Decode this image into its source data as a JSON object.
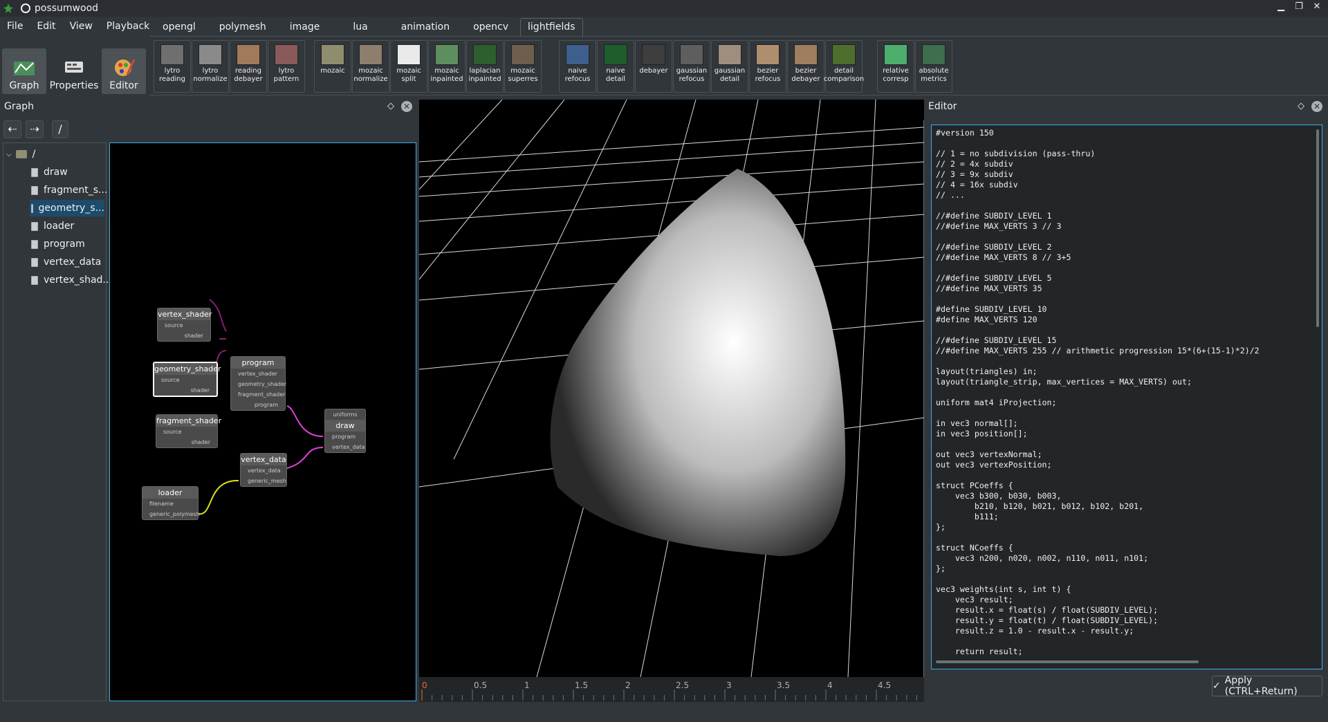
{
  "window": {
    "title": "possumwood",
    "controls": [
      "minimize-icon",
      "restore-icon",
      "close-icon"
    ]
  },
  "menu": [
    "File",
    "Edit",
    "View",
    "Playback"
  ],
  "tabs": [
    {
      "label": "opengl",
      "active": false
    },
    {
      "label": "polymesh",
      "active": false
    },
    {
      "label": "image",
      "active": false
    },
    {
      "label": "lua",
      "active": false
    },
    {
      "label": "animation",
      "active": false
    },
    {
      "label": "opencv",
      "active": false
    },
    {
      "label": "lightfields",
      "active": true
    }
  ],
  "modes": [
    {
      "label": "Graph",
      "icon": "graph-icon",
      "active": true
    },
    {
      "label": "Properties",
      "icon": "properties-icon",
      "active": false
    },
    {
      "label": "Editor",
      "icon": "editor-icon",
      "active": true
    }
  ],
  "tools": [
    {
      "label": "lytro\nreading",
      "thumb": "#6f6f70"
    },
    {
      "label": "lytro\nnormalize",
      "thumb": "#8a8a8a"
    },
    {
      "label": "reading\ndebayer",
      "thumb": "#a07a5a"
    },
    {
      "label": "lytro\npattern",
      "thumb": "#8a5a5a"
    },
    {
      "label": "mozaic",
      "thumb": "#8e8e6e"
    },
    {
      "label": "mozaic\nnormalize",
      "thumb": "#8e7e6e"
    },
    {
      "label": "mozaic\nsplit",
      "thumb": "#eaeaea"
    },
    {
      "label": "mozaic\ninpainted",
      "thumb": "#5e8e5e"
    },
    {
      "label": "laplacian\ninpainted",
      "thumb": "#2e5e2e"
    },
    {
      "label": "mozaic\nsuperres",
      "thumb": "#6e5e4e"
    },
    {
      "label": "naive\nrefocus",
      "thumb": "#3e5e8e"
    },
    {
      "label": "naive\ndetail",
      "thumb": "#1e5e2e"
    },
    {
      "label": "debayer",
      "thumb": "#3e3e3e"
    },
    {
      "label": "gaussian\nrefocus",
      "thumb": "#5e5e5e"
    },
    {
      "label": "gaussian\ndetail",
      "thumb": "#9e8e7e"
    },
    {
      "label": "bezier\nrefocus",
      "thumb": "#ae8e6e"
    },
    {
      "label": "bezier\ndebayer",
      "thumb": "#9e7e5e"
    },
    {
      "label": "detail\ncomparison",
      "thumb": "#4e6e2e"
    },
    {
      "label": "relative\ncorresp",
      "thumb": "#4eae6e"
    },
    {
      "label": "absolute\nmetrics",
      "thumb": "#3e6e4e"
    }
  ],
  "graph_panel": {
    "title": "Graph",
    "path": "/",
    "root": "/",
    "items": [
      "draw",
      "fragment_s...",
      "geometry_s...",
      "loader",
      "program",
      "vertex_data",
      "vertex_shad..."
    ],
    "selected": "geometry_s..."
  },
  "nodes": {
    "vertex_shader": {
      "title": "vertex_shader",
      "in": "source",
      "out": "shader"
    },
    "geometry_shader": {
      "title": "geometry_shader",
      "in": "source",
      "out": "shader"
    },
    "fragment_shader": {
      "title": "fragment_shader",
      "in": "source",
      "out": "shader"
    },
    "program": {
      "title": "program",
      "ins": [
        "vertex_shader",
        "geometry_shader",
        "fragment_shader"
      ],
      "out": "program"
    },
    "draw": {
      "title": "draw",
      "top": "uniforms",
      "ins": [
        "program",
        "vertex_data"
      ]
    },
    "vertex_data": {
      "title": "vertex_data",
      "in": "vertex_data",
      "out": "generic_mesh"
    },
    "loader": {
      "title": "loader",
      "in": "filename",
      "out": "generic_polymesh"
    }
  },
  "timeline": {
    "ticks": [
      "0",
      "0.5",
      "1",
      "1.5",
      "2",
      "2.5",
      "3",
      "3.5",
      "4",
      "4.5"
    ]
  },
  "editor": {
    "title": "Editor",
    "apply": "Apply (CTRL+Return)",
    "code": "#version 150\n\n// 1 = no subdivision (pass-thru)\n// 2 = 4x subdiv\n// 3 = 9x subdiv\n// 4 = 16x subdiv\n// ...\n\n//#define SUBDIV_LEVEL 1\n//#define MAX_VERTS 3 // 3\n\n//#define SUBDIV_LEVEL 2\n//#define MAX_VERTS 8 // 3+5\n\n//#define SUBDIV_LEVEL 5\n//#define MAX_VERTS 35\n\n#define SUBDIV_LEVEL 10\n#define MAX_VERTS 120\n\n//#define SUBDIV_LEVEL 15\n//#define MAX_VERTS 255 // arithmetic progression 15*(6+(15-1)*2)/2\n\nlayout(triangles) in;\nlayout(triangle_strip, max_vertices = MAX_VERTS) out;\n\nuniform mat4 iProjection;\n\nin vec3 normal[];\nin vec3 position[];\n\nout vec3 vertexNormal;\nout vec3 vertexPosition;\n\nstruct PCoeffs {\n    vec3 b300, b030, b003,\n        b210, b120, b021, b012, b102, b201,\n        b111;\n};\n\nstruct NCoeffs {\n    vec3 n200, n020, n002, n110, n011, n101;\n};\n\nvec3 weights(int s, int t) {\n    vec3 result;\n    result.x = float(s) / float(SUBDIV_LEVEL);\n    result.y = float(t) / float(SUBDIV_LEVEL);\n    result.z = 1.0 - result.x - result.y;\n\n    return result;"
  }
}
